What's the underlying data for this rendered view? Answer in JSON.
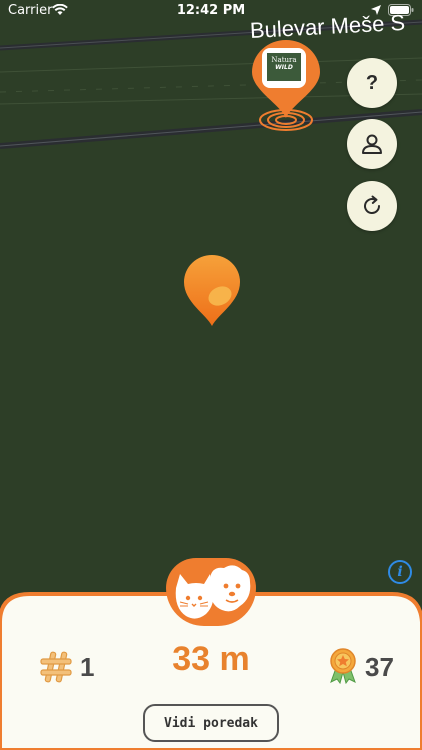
{
  "status_bar": {
    "carrier": "Carrier",
    "time": "12:42 PM"
  },
  "map": {
    "street_label": "Bulevar Meše S",
    "poi_logo": {
      "line1": "Natura",
      "line2": "WILD"
    }
  },
  "side_buttons": {
    "help_label": "?"
  },
  "panel": {
    "rank": "1",
    "distance": "33 m",
    "points": "37",
    "leaderboard_button": "Vidi poredak"
  },
  "colors": {
    "map_background": "#2d3e27",
    "accent_orange": "#ef7d2f",
    "button_background": "#f4f3df",
    "panel_background": "#fbfbf3",
    "info_blue": "#2f8be6"
  }
}
